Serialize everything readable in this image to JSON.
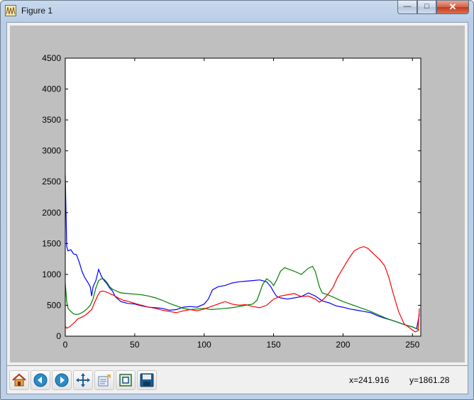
{
  "window": {
    "title": "Figure 1",
    "minimize_glyph": "—",
    "maximize_glyph": "□",
    "close_glyph": "✕"
  },
  "toolbar": {
    "buttons": [
      "home-icon",
      "back-icon",
      "forward-icon",
      "pan-icon",
      "configure-subplots-icon",
      "zoom-icon",
      "save-icon"
    ],
    "x_readout": "x=241.916",
    "y_readout": "y=1861.28"
  },
  "chart_data": {
    "type": "line",
    "xlim": [
      0,
      256
    ],
    "ylim": [
      0,
      4500
    ],
    "x_ticks": [
      0,
      50,
      100,
      150,
      200,
      250
    ],
    "y_ticks": [
      0,
      500,
      1000,
      1500,
      2000,
      2500,
      3000,
      3500,
      4000,
      4500
    ],
    "title": "",
    "xlabel": "",
    "ylabel": "",
    "series": [
      {
        "color": "#0000ff",
        "points": [
          [
            0,
            2600
          ],
          [
            1,
            1450
          ],
          [
            2,
            1380
          ],
          [
            4,
            1400
          ],
          [
            6,
            1330
          ],
          [
            8,
            1320
          ],
          [
            10,
            1200
          ],
          [
            12,
            1050
          ],
          [
            14,
            950
          ],
          [
            16,
            880
          ],
          [
            18,
            800
          ],
          [
            19,
            650
          ],
          [
            20,
            800
          ],
          [
            22,
            900
          ],
          [
            24,
            1080
          ],
          [
            26,
            970
          ],
          [
            28,
            900
          ],
          [
            30,
            850
          ],
          [
            32,
            780
          ],
          [
            34,
            730
          ],
          [
            36,
            640
          ],
          [
            38,
            600
          ],
          [
            40,
            560
          ],
          [
            45,
            530
          ],
          [
            50,
            520
          ],
          [
            55,
            490
          ],
          [
            60,
            470
          ],
          [
            65,
            460
          ],
          [
            70,
            450
          ],
          [
            75,
            420
          ],
          [
            80,
            430
          ],
          [
            85,
            470
          ],
          [
            90,
            480
          ],
          [
            95,
            470
          ],
          [
            100,
            520
          ],
          [
            103,
            600
          ],
          [
            106,
            750
          ],
          [
            110,
            800
          ],
          [
            115,
            820
          ],
          [
            120,
            860
          ],
          [
            125,
            880
          ],
          [
            130,
            890
          ],
          [
            135,
            900
          ],
          [
            140,
            910
          ],
          [
            145,
            880
          ],
          [
            148,
            800
          ],
          [
            150,
            720
          ],
          [
            152,
            650
          ],
          [
            155,
            620
          ],
          [
            160,
            600
          ],
          [
            165,
            620
          ],
          [
            170,
            640
          ],
          [
            175,
            700
          ],
          [
            180,
            650
          ],
          [
            185,
            570
          ],
          [
            190,
            540
          ],
          [
            195,
            490
          ],
          [
            200,
            470
          ],
          [
            205,
            440
          ],
          [
            210,
            420
          ],
          [
            215,
            400
          ],
          [
            220,
            380
          ],
          [
            225,
            330
          ],
          [
            230,
            290
          ],
          [
            235,
            260
          ],
          [
            240,
            220
          ],
          [
            245,
            180
          ],
          [
            250,
            150
          ],
          [
            253,
            120
          ],
          [
            255,
            350
          ]
        ]
      },
      {
        "color": "#008000",
        "points": [
          [
            0,
            850
          ],
          [
            1,
            560
          ],
          [
            2,
            450
          ],
          [
            4,
            400
          ],
          [
            6,
            360
          ],
          [
            8,
            350
          ],
          [
            10,
            360
          ],
          [
            12,
            380
          ],
          [
            14,
            410
          ],
          [
            16,
            450
          ],
          [
            18,
            500
          ],
          [
            20,
            600
          ],
          [
            22,
            780
          ],
          [
            24,
            900
          ],
          [
            26,
            930
          ],
          [
            28,
            920
          ],
          [
            30,
            870
          ],
          [
            32,
            800
          ],
          [
            34,
            760
          ],
          [
            36,
            740
          ],
          [
            38,
            720
          ],
          [
            40,
            700
          ],
          [
            45,
            690
          ],
          [
            50,
            680
          ],
          [
            55,
            670
          ],
          [
            60,
            650
          ],
          [
            65,
            620
          ],
          [
            70,
            580
          ],
          [
            75,
            530
          ],
          [
            80,
            490
          ],
          [
            85,
            450
          ],
          [
            90,
            430
          ],
          [
            95,
            440
          ],
          [
            100,
            450
          ],
          [
            105,
            430
          ],
          [
            110,
            440
          ],
          [
            115,
            450
          ],
          [
            120,
            460
          ],
          [
            125,
            480
          ],
          [
            130,
            500
          ],
          [
            135,
            520
          ],
          [
            138,
            580
          ],
          [
            140,
            700
          ],
          [
            142,
            830
          ],
          [
            145,
            930
          ],
          [
            148,
            880
          ],
          [
            150,
            820
          ],
          [
            152,
            900
          ],
          [
            155,
            1050
          ],
          [
            158,
            1110
          ],
          [
            160,
            1090
          ],
          [
            165,
            1050
          ],
          [
            170,
            1000
          ],
          [
            175,
            1100
          ],
          [
            178,
            1130
          ],
          [
            180,
            1050
          ],
          [
            183,
            800
          ],
          [
            185,
            700
          ],
          [
            188,
            680
          ],
          [
            192,
            640
          ],
          [
            196,
            600
          ],
          [
            200,
            560
          ],
          [
            205,
            520
          ],
          [
            210,
            480
          ],
          [
            215,
            440
          ],
          [
            220,
            400
          ],
          [
            225,
            350
          ],
          [
            230,
            300
          ],
          [
            235,
            260
          ],
          [
            240,
            220
          ],
          [
            245,
            180
          ],
          [
            250,
            150
          ],
          [
            253,
            120
          ],
          [
            255,
            100
          ]
        ]
      },
      {
        "color": "#ff0000",
        "points": [
          [
            0,
            160
          ],
          [
            1,
            130
          ],
          [
            3,
            150
          ],
          [
            5,
            190
          ],
          [
            7,
            230
          ],
          [
            9,
            280
          ],
          [
            11,
            300
          ],
          [
            13,
            320
          ],
          [
            15,
            350
          ],
          [
            17,
            390
          ],
          [
            19,
            430
          ],
          [
            21,
            540
          ],
          [
            23,
            640
          ],
          [
            25,
            720
          ],
          [
            27,
            730
          ],
          [
            29,
            720
          ],
          [
            31,
            700
          ],
          [
            33,
            680
          ],
          [
            35,
            660
          ],
          [
            38,
            620
          ],
          [
            42,
            580
          ],
          [
            46,
            560
          ],
          [
            50,
            530
          ],
          [
            55,
            500
          ],
          [
            60,
            470
          ],
          [
            65,
            450
          ],
          [
            70,
            420
          ],
          [
            75,
            400
          ],
          [
            80,
            380
          ],
          [
            85,
            410
          ],
          [
            90,
            430
          ],
          [
            95,
            410
          ],
          [
            100,
            440
          ],
          [
            105,
            480
          ],
          [
            110,
            520
          ],
          [
            115,
            560
          ],
          [
            120,
            520
          ],
          [
            125,
            500
          ],
          [
            130,
            510
          ],
          [
            135,
            480
          ],
          [
            140,
            460
          ],
          [
            145,
            500
          ],
          [
            150,
            600
          ],
          [
            155,
            650
          ],
          [
            160,
            670
          ],
          [
            165,
            690
          ],
          [
            170,
            640
          ],
          [
            175,
            650
          ],
          [
            180,
            600
          ],
          [
            183,
            550
          ],
          [
            186,
            600
          ],
          [
            190,
            700
          ],
          [
            193,
            800
          ],
          [
            196,
            950
          ],
          [
            200,
            1100
          ],
          [
            204,
            1250
          ],
          [
            208,
            1380
          ],
          [
            212,
            1430
          ],
          [
            215,
            1450
          ],
          [
            218,
            1420
          ],
          [
            222,
            1330
          ],
          [
            226,
            1250
          ],
          [
            230,
            1140
          ],
          [
            233,
            950
          ],
          [
            236,
            700
          ],
          [
            240,
            400
          ],
          [
            244,
            200
          ],
          [
            247,
            150
          ],
          [
            250,
            100
          ],
          [
            252,
            70
          ],
          [
            254,
            90
          ],
          [
            255,
            450
          ]
        ]
      }
    ]
  }
}
